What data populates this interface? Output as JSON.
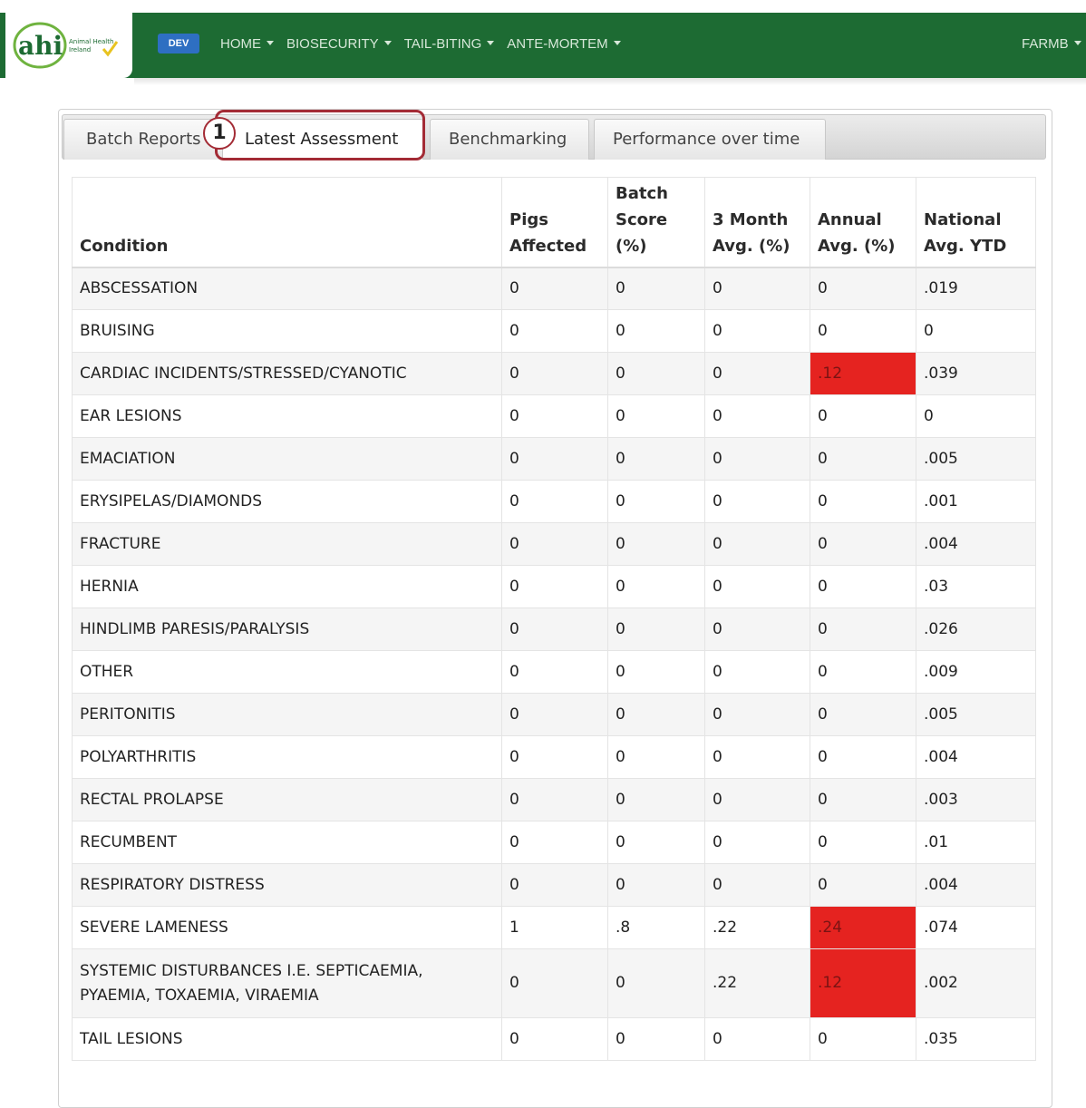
{
  "navbar": {
    "logo_text": "ahi",
    "logo_tagline_1": "Animal Health",
    "logo_tagline_2": "Ireland",
    "env_badge": "DEV",
    "menu": [
      {
        "label": "HOME"
      },
      {
        "label": "BIOSECURITY"
      },
      {
        "label": "TAIL-BITING"
      },
      {
        "label": "ANTE-MORTEM"
      }
    ],
    "user": "FARMB"
  },
  "tabs": [
    {
      "label": "Batch Reports"
    },
    {
      "label": "Latest Assessment"
    },
    {
      "label": "Benchmarking"
    },
    {
      "label": "Performance over time"
    }
  ],
  "active_tab": "Latest Assessment",
  "callout_number": "1",
  "table": {
    "headers": [
      {
        "line1": "Condition",
        "line2": "",
        "line3": ""
      },
      {
        "line1": "Pigs",
        "line2": "Affected",
        "line3": ""
      },
      {
        "line1": "Batch",
        "line2": "Score",
        "line3": "(%)"
      },
      {
        "line1": "3 Month",
        "line2": "Avg. (%)",
        "line3": ""
      },
      {
        "line1": "Annual",
        "line2": "Avg. (%)",
        "line3": ""
      },
      {
        "line1": "National",
        "line2": "Avg. YTD",
        "line3": ""
      }
    ],
    "rows": [
      {
        "condition": "ABSCESSATION",
        "pigs_affected": "0",
        "batch_score": "0",
        "three_month": "0",
        "annual": "0",
        "national": ".019",
        "annual_flag": false
      },
      {
        "condition": "BRUISING",
        "pigs_affected": "0",
        "batch_score": "0",
        "three_month": "0",
        "annual": "0",
        "national": "0",
        "annual_flag": false
      },
      {
        "condition": "CARDIAC INCIDENTS/STRESSED/CYANOTIC",
        "pigs_affected": "0",
        "batch_score": "0",
        "three_month": "0",
        "annual": ".12",
        "national": ".039",
        "annual_flag": true
      },
      {
        "condition": "EAR LESIONS",
        "pigs_affected": "0",
        "batch_score": "0",
        "three_month": "0",
        "annual": "0",
        "national": "0",
        "annual_flag": false
      },
      {
        "condition": "EMACIATION",
        "pigs_affected": "0",
        "batch_score": "0",
        "three_month": "0",
        "annual": "0",
        "national": ".005",
        "annual_flag": false
      },
      {
        "condition": "ERYSIPELAS/DIAMONDS",
        "pigs_affected": "0",
        "batch_score": "0",
        "three_month": "0",
        "annual": "0",
        "national": ".001",
        "annual_flag": false
      },
      {
        "condition": "FRACTURE",
        "pigs_affected": "0",
        "batch_score": "0",
        "three_month": "0",
        "annual": "0",
        "national": ".004",
        "annual_flag": false
      },
      {
        "condition": "HERNIA",
        "pigs_affected": "0",
        "batch_score": "0",
        "three_month": "0",
        "annual": "0",
        "national": ".03",
        "annual_flag": false
      },
      {
        "condition": "HINDLIMB PARESIS/PARALYSIS",
        "pigs_affected": "0",
        "batch_score": "0",
        "three_month": "0",
        "annual": "0",
        "national": ".026",
        "annual_flag": false
      },
      {
        "condition": "OTHER",
        "pigs_affected": "0",
        "batch_score": "0",
        "three_month": "0",
        "annual": "0",
        "national": ".009",
        "annual_flag": false
      },
      {
        "condition": "PERITONITIS",
        "pigs_affected": "0",
        "batch_score": "0",
        "three_month": "0",
        "annual": "0",
        "national": ".005",
        "annual_flag": false
      },
      {
        "condition": "POLYARTHRITIS",
        "pigs_affected": "0",
        "batch_score": "0",
        "three_month": "0",
        "annual": "0",
        "national": ".004",
        "annual_flag": false
      },
      {
        "condition": "RECTAL PROLAPSE",
        "pigs_affected": "0",
        "batch_score": "0",
        "three_month": "0",
        "annual": "0",
        "national": ".003",
        "annual_flag": false
      },
      {
        "condition": "RECUMBENT",
        "pigs_affected": "0",
        "batch_score": "0",
        "three_month": "0",
        "annual": "0",
        "national": ".01",
        "annual_flag": false
      },
      {
        "condition": "RESPIRATORY DISTRESS",
        "pigs_affected": "0",
        "batch_score": "0",
        "three_month": "0",
        "annual": "0",
        "national": ".004",
        "annual_flag": false
      },
      {
        "condition": "SEVERE LAMENESS",
        "pigs_affected": "1",
        "batch_score": ".8",
        "three_month": ".22",
        "annual": ".24",
        "national": ".074",
        "annual_flag": true
      },
      {
        "condition": "SYSTEMIC DISTURBANCES I.E. SEPTICAEMIA, PYAEMIA, TOXAEMIA, VIRAEMIA",
        "pigs_affected": "0",
        "batch_score": "0",
        "three_month": ".22",
        "annual": ".12",
        "national": ".002",
        "annual_flag": true
      },
      {
        "condition": "TAIL LESIONS",
        "pigs_affected": "0",
        "batch_score": "0",
        "three_month": "0",
        "annual": "0",
        "national": ".035",
        "annual_flag": false
      }
    ]
  },
  "colors": {
    "navbar": "#1d6b33",
    "badge": "#2e6fc2",
    "highlight": "#a32b35",
    "alert": "#e52320"
  }
}
